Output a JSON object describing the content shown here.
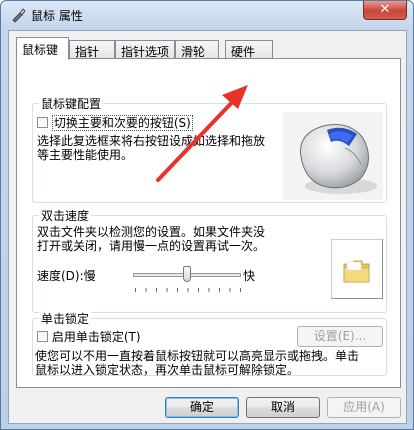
{
  "window": {
    "title": "鼠标 属性",
    "close_glyph": "✕"
  },
  "tabs": [
    {
      "label": "鼠标键"
    },
    {
      "label": "指针"
    },
    {
      "label": "指针选项"
    },
    {
      "label": "滑轮"
    },
    {
      "label": "硬件"
    }
  ],
  "button_config": {
    "title": "鼠标键配置",
    "checkbox_label": "切换主要和次要的按钮(S)",
    "checked": false,
    "description_line1": "选择此复选框来将右按钮设成如选择和拖放",
    "description_line2": "等主要性能使用。"
  },
  "double_click": {
    "title": "双击速度",
    "description_line1": "双击文件夹以检测您的设置。如果文件夹没",
    "description_line2": "打开或关闭，请用慢一点的设置再试一次。",
    "speed_label": "速度(D):慢",
    "fast_label": "快",
    "slider_value": 0.5
  },
  "click_lock": {
    "title": "单击锁定",
    "checkbox_label": "启用单击锁定(T)",
    "checked": false,
    "settings_button": "设置(E)...",
    "description_line1": "使您可以不用一直按着鼠标按钮就可以高亮显示或拖拽。单击",
    "description_line2": "鼠标以进入锁定状态，再次单击鼠标可解除锁定。"
  },
  "footer": {
    "ok": "确定",
    "cancel": "取消",
    "apply": "应用(A)"
  },
  "colors": {
    "annotation_arrow": "#e8322a"
  }
}
